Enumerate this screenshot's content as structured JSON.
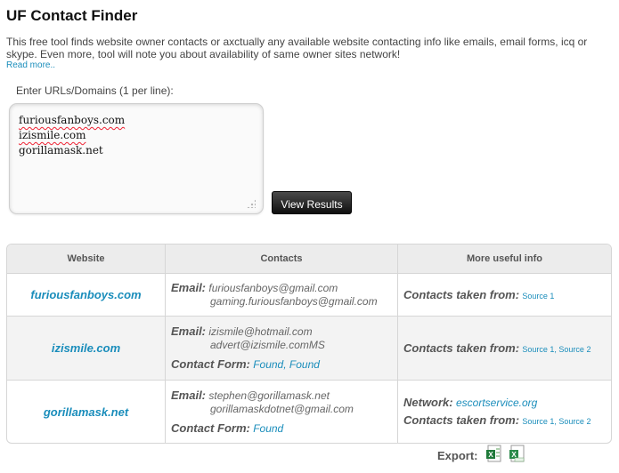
{
  "header": {
    "title": "UF Contact Finder",
    "description": "This free tool finds website owner contacts or axctually any available website contacting info like emails, email forms, icq or skype. Even more, tool will note you about availability of same owner sites network!",
    "read_more": "Read more.."
  },
  "form": {
    "label": "Enter URLs/Domains (1 per line):",
    "urls": [
      "furiousfanboys.com",
      "izismile.com",
      "gorillamask.net"
    ],
    "submit_label": "View Results"
  },
  "table": {
    "headers": [
      "Website",
      "Contacts",
      "More useful info"
    ],
    "email_label": "Email:",
    "contact_form_label": "Contact Form:",
    "contacts_taken_label": "Contacts taken from:",
    "network_label": "Network:",
    "rows": [
      {
        "site": "furiousfanboys.com",
        "emails": [
          "furiousfanboys@gmail.com",
          "gaming.furiousfanboys@gmail.com"
        ],
        "sources": [
          "Source 1"
        ]
      },
      {
        "site": "izismile.com",
        "emails": [
          "izismile@hotmail.com",
          "advert@izismile.comMS"
        ],
        "forms": [
          "Found",
          "Found"
        ],
        "sources": [
          "Source 1",
          "Source 2"
        ]
      },
      {
        "site": "gorillamask.net",
        "emails": [
          "stephen@gorillamask.net",
          "gorillamaskdotnet@gmail.com"
        ],
        "forms": [
          "Found"
        ],
        "network": "escortservice.org",
        "sources": [
          "Source 1",
          "Source 2"
        ]
      }
    ]
  },
  "export": {
    "label": "Export:",
    "icons": [
      "excel-xls-icon",
      "csv-icon"
    ]
  },
  "colors": {
    "link": "#1a8dbb",
    "header_bg": "#ececec",
    "button_bg": "#1a1a1a"
  }
}
